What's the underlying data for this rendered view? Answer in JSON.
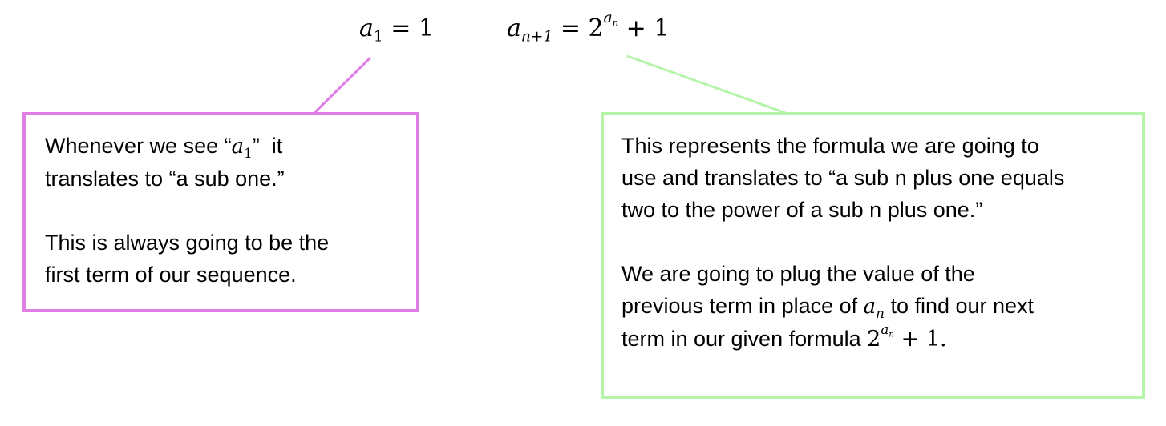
{
  "formulas": {
    "first_term": {
      "var": "a",
      "sub": "1",
      "eq": " = ",
      "value": "1"
    },
    "recursive": {
      "var": "a",
      "sub": "n+1",
      "eq": " = ",
      "base": "2",
      "exp_var": "a",
      "exp_sub": "n",
      "tail": " + 1"
    }
  },
  "colors": {
    "pink": "#e07ee6",
    "green": "#b5f5a9"
  },
  "pink_box": {
    "line1_pre": "Whenever we see “",
    "line1_var": "a",
    "line1_sub": "1",
    "line1_post": "”  it",
    "line2": "translates to “a sub one.”",
    "para2_line1": "This is always going to be the",
    "para2_line2": "first term of our sequence."
  },
  "green_box": {
    "line1": "This represents the formula we are going to",
    "line2": "use and translates to “a sub n plus one equals",
    "line3": "two to the power of a sub n plus one.”",
    "para2_line1": "We are going to plug the value of the",
    "para2_line2_pre": "previous term in place of ",
    "para2_line2_var": "a",
    "para2_line2_sub": "n",
    "para2_line2_post": " to find our next",
    "para2_line3_pre": "term in our given formula ",
    "para2_line3_base": "2",
    "para2_line3_exp_var": "a",
    "para2_line3_exp_sub": "n",
    "para2_line3_post": " + 1."
  }
}
